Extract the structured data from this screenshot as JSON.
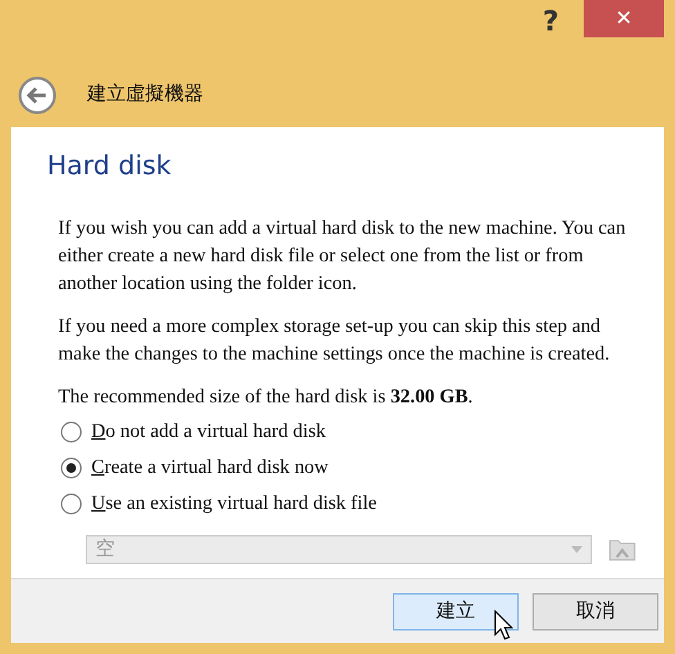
{
  "window": {
    "help": "?",
    "close": "✕"
  },
  "header": {
    "title": "建立虛擬機器"
  },
  "page": {
    "heading": "Hard disk",
    "paragraphs": [
      "If you wish you can add a virtual hard disk to the new machine. You can either create a new hard disk file or select one from the list or from another location using the folder icon.",
      "If you need a more complex storage set-up you can skip this step and make the changes to the machine settings once the machine is created.",
      "The recommended size of the hard disk is **32.00 GB**."
    ],
    "options": [
      {
        "label": "Do not add a virtual hard disk",
        "selected": false
      },
      {
        "label": "Create a virtual hard disk now",
        "selected": true
      },
      {
        "label": "Use an existing virtual hard disk file",
        "selected": false
      }
    ],
    "disk_select": {
      "value": "空",
      "disabled": true
    }
  },
  "buttons": [
    {
      "label": "建立",
      "default": true,
      "hovered": true
    },
    {
      "label": "取消",
      "default": false,
      "hovered": false
    }
  ]
}
